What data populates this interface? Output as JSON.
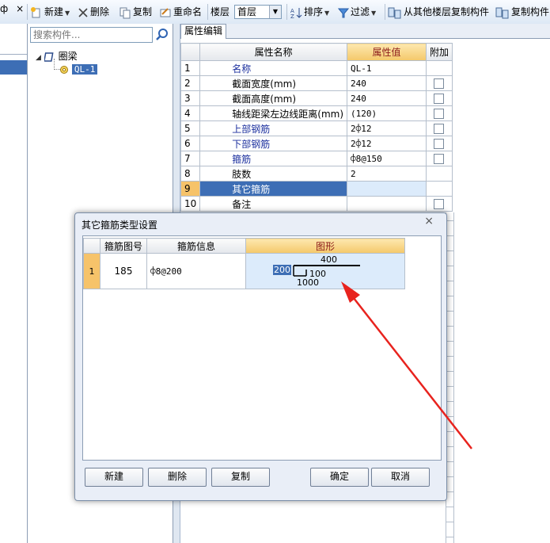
{
  "toolbar": {
    "pin": "ф",
    "close": "×",
    "new_label": "新建",
    "delete_label": "删除",
    "copy_label": "复制",
    "rename_label": "重命名",
    "floor_label": "楼层",
    "floor_value": "首层",
    "sort_label": "排序",
    "filter_label": "过滤",
    "copy_from_floor_label": "从其他楼层复制构件",
    "copy_component_label": "复制构件"
  },
  "sidebar": {
    "search_placeholder": "搜索构件...",
    "tree_root": "圈梁",
    "tree_child": "QL-1"
  },
  "panel": {
    "tab": "属性编辑",
    "headers": {
      "name": "属性名称",
      "value": "属性值",
      "extra": "附加"
    },
    "rows": [
      {
        "num": "1",
        "name": "名称",
        "value": "QL-1",
        "blue": true,
        "check": false
      },
      {
        "num": "2",
        "name": "截面宽度(mm)",
        "value": "240",
        "blue": false,
        "check": true
      },
      {
        "num": "3",
        "name": "截面高度(mm)",
        "value": "240",
        "blue": false,
        "check": true
      },
      {
        "num": "4",
        "name": "轴线距梁左边线距离(mm)",
        "value": "(120)",
        "blue": false,
        "check": true
      },
      {
        "num": "5",
        "name": "上部钢筋",
        "value": "2⌽12",
        "blue": true,
        "check": true
      },
      {
        "num": "6",
        "name": "下部钢筋",
        "value": "2⌽12",
        "blue": true,
        "check": true
      },
      {
        "num": "7",
        "name": "箍筋",
        "value": "⌽8@150",
        "blue": true,
        "check": true
      },
      {
        "num": "8",
        "name": "肢数",
        "value": "2",
        "blue": false,
        "check": false
      },
      {
        "num": "9",
        "name": "其它箍筋",
        "value": "",
        "blue": false,
        "check": false,
        "selected": true
      },
      {
        "num": "10",
        "name": "备注",
        "value": "",
        "blue": false,
        "check": true
      }
    ]
  },
  "dialog": {
    "title": "其它箍筋类型设置",
    "close": "×",
    "headers": {
      "code": "箍筋图号",
      "info": "箍筋信息",
      "shape": "图形"
    },
    "row": {
      "num": "1",
      "code": "185",
      "info": "⌽8@200",
      "dim_top": "400",
      "dim_left": "200",
      "dim_hook": "100",
      "dim_bottom": "1000"
    },
    "buttons": {
      "new": "新建",
      "delete": "删除",
      "copy": "复制",
      "ok": "确定",
      "cancel": "取消"
    }
  },
  "colors": {
    "selection_blue": "#3d6eb5",
    "header_orange": "#f4c86a",
    "arrow_red": "#e8231e"
  }
}
